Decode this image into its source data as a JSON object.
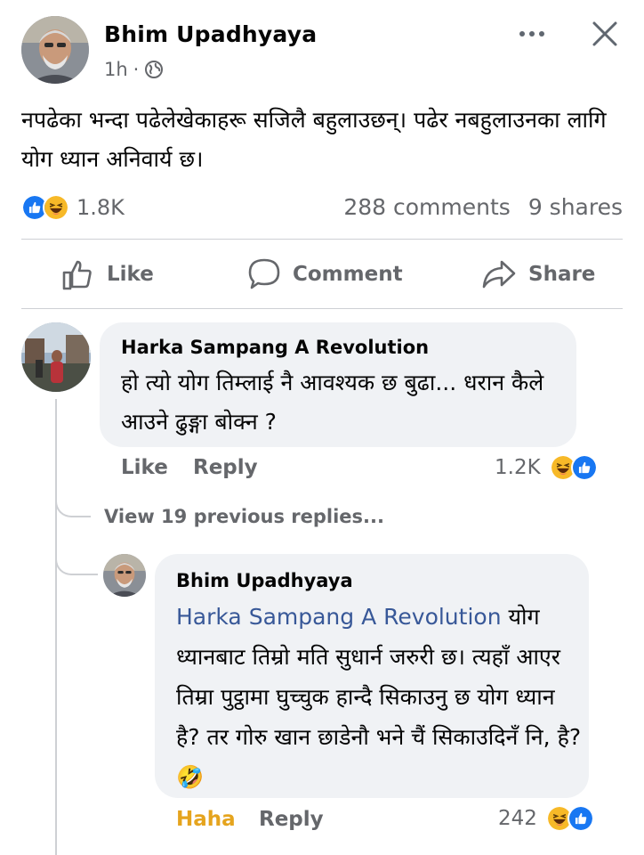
{
  "post": {
    "author": "Bhim Upadhyaya",
    "time": "1h",
    "separator": "·",
    "text": "नपढेका भन्दा पढेलेखेकाहरू सजिलै बहुलाउछन्। पढेर नबहुलाउनका लागि योग ध्यान अनिवार्य छ।",
    "reactions_count": "1.8K",
    "comments_count": "288 comments",
    "shares_count": "9 shares"
  },
  "actions": {
    "like": "Like",
    "comment": "Comment",
    "share": "Share"
  },
  "comments": [
    {
      "author": "Harka Sampang A Revolution",
      "text": "हो त्यो योग तिम्लाई नै आवश्यक छ बुढा... धरान कैले आउने ढुङ्गा बोक्न ?",
      "like_label": "Like",
      "reply_label": "Reply",
      "reaction_count": "1.2K",
      "view_previous": "View 19 previous replies...",
      "reply": {
        "author": "Bhim Upadhyaya",
        "mention": "Harka Sampang A Revolution",
        "text": " योग ध्यानबाट तिम्रो मति सुधार्न जरुरी छ। त्यहाँ आएर तिम्रा पुट्ठामा घुच्चुक हान्दै सिकाउनु छ योग ध्यान है? तर गोरु खान छाडेनौ  भने चैं सिकाउदिनँ नि,  है? 🤣",
        "haha_label": "Haha",
        "reply_label": "Reply",
        "reaction_count": "242"
      }
    }
  ],
  "colors": {
    "like_blue": "#1877f2",
    "haha_yellow": "#f7b928",
    "mention": "#385898",
    "muted": "#65676b",
    "bubble": "#f0f2f5"
  }
}
